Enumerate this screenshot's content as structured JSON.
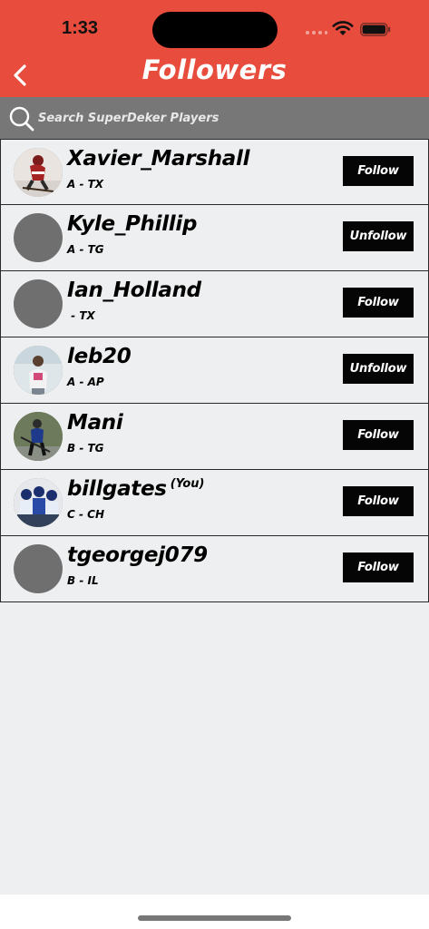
{
  "status": {
    "time": "1:33"
  },
  "header": {
    "title": "Followers"
  },
  "search": {
    "placeholder": "Search SuperDeker Players"
  },
  "colors": {
    "accent": "#e74c3c",
    "search_bg": "#777777",
    "button_bg": "#050505",
    "avatar_placeholder": "#6f6f6f"
  },
  "followers": [
    {
      "username": "Xavier_Marshall",
      "meta": "A - TX",
      "button": "Follow",
      "avatar": "photo-hockey-player-red"
    },
    {
      "username": "Kyle_Phillip",
      "meta": "A - TG",
      "button": "Unfollow",
      "avatar": "placeholder"
    },
    {
      "username": "Ian_Holland",
      "meta": " - TX",
      "button": "Follow",
      "avatar": "placeholder"
    },
    {
      "username": "leb20",
      "meta": "A - AP",
      "button": "Unfollow",
      "avatar": "photo-person-standing"
    },
    {
      "username": "Mani",
      "meta": "B - TG",
      "button": "Follow",
      "avatar": "photo-hockey-player-blue"
    },
    {
      "username": "billgates",
      "you_tag": "(You)",
      "meta": "C - CH",
      "button": "Follow",
      "avatar": "photo-team-group"
    },
    {
      "username": "tgeorgej079",
      "meta": "B - IL",
      "button": "Follow",
      "avatar": "placeholder"
    }
  ]
}
